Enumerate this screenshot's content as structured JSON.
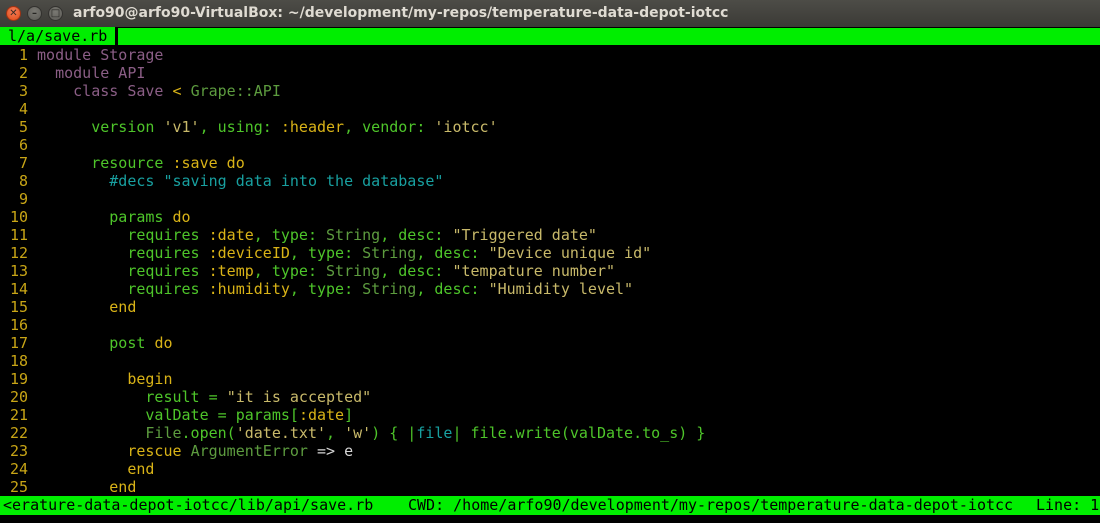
{
  "window": {
    "title": "arfo90@arfo90-VirtualBox: ~/development/my-repos/temperature-data-depot-iotcc",
    "close_glyph": "✕",
    "minimize_glyph": "–",
    "maximize_glyph": "□"
  },
  "tab": {
    "label": "l/a/save.rb"
  },
  "lines": [
    {
      "n": "1",
      "seg": [
        {
          "t": "module Storage",
          "c": "pur"
        }
      ]
    },
    {
      "n": "2",
      "seg": [
        {
          "t": "  module API",
          "c": "pur"
        }
      ]
    },
    {
      "n": "3",
      "seg": [
        {
          "t": "    class Save ",
          "c": "pur"
        },
        {
          "t": "< ",
          "c": "yel"
        },
        {
          "t": "Grape::API",
          "c": "cls"
        }
      ]
    },
    {
      "n": "4",
      "seg": []
    },
    {
      "n": "5",
      "seg": [
        {
          "t": "      version ",
          "c": "grn"
        },
        {
          "t": "'v1'",
          "c": "str"
        },
        {
          "t": ", using: ",
          "c": "grn"
        },
        {
          "t": ":header",
          "c": "yel"
        },
        {
          "t": ", vendor: ",
          "c": "grn"
        },
        {
          "t": "'iotcc'",
          "c": "str"
        }
      ]
    },
    {
      "n": "6",
      "seg": []
    },
    {
      "n": "7",
      "seg": [
        {
          "t": "      resource ",
          "c": "grn"
        },
        {
          "t": ":save",
          "c": "yel"
        },
        {
          "t": " do",
          "c": "yel"
        }
      ]
    },
    {
      "n": "8",
      "seg": [
        {
          "t": "        #decs \"saving data into the database\"",
          "c": "teal"
        }
      ]
    },
    {
      "n": "9",
      "seg": []
    },
    {
      "n": "10",
      "seg": [
        {
          "t": "        params ",
          "c": "grn"
        },
        {
          "t": "do",
          "c": "yel"
        }
      ]
    },
    {
      "n": "11",
      "seg": [
        {
          "t": "          requires ",
          "c": "grn"
        },
        {
          "t": ":date",
          "c": "yel"
        },
        {
          "t": ", type: ",
          "c": "grn"
        },
        {
          "t": "String",
          "c": "cls"
        },
        {
          "t": ", desc: ",
          "c": "grn"
        },
        {
          "t": "\"Triggered date\"",
          "c": "str"
        }
      ]
    },
    {
      "n": "12",
      "seg": [
        {
          "t": "          requires ",
          "c": "grn"
        },
        {
          "t": ":deviceID",
          "c": "yel"
        },
        {
          "t": ", type: ",
          "c": "grn"
        },
        {
          "t": "String",
          "c": "cls"
        },
        {
          "t": ", desc: ",
          "c": "grn"
        },
        {
          "t": "\"Device unique id\"",
          "c": "str"
        }
      ]
    },
    {
      "n": "13",
      "seg": [
        {
          "t": "          requires ",
          "c": "grn"
        },
        {
          "t": ":temp",
          "c": "yel"
        },
        {
          "t": ", type: ",
          "c": "grn"
        },
        {
          "t": "String",
          "c": "cls"
        },
        {
          "t": ", desc: ",
          "c": "grn"
        },
        {
          "t": "\"tempature number\"",
          "c": "str"
        }
      ]
    },
    {
      "n": "14",
      "seg": [
        {
          "t": "          requires ",
          "c": "grn"
        },
        {
          "t": ":humidity",
          "c": "yel"
        },
        {
          "t": ", type: ",
          "c": "grn"
        },
        {
          "t": "String",
          "c": "cls"
        },
        {
          "t": ", desc: ",
          "c": "grn"
        },
        {
          "t": "\"Humidity level\"",
          "c": "str"
        }
      ]
    },
    {
      "n": "15",
      "seg": [
        {
          "t": "        end",
          "c": "yel"
        }
      ]
    },
    {
      "n": "16",
      "seg": []
    },
    {
      "n": "17",
      "seg": [
        {
          "t": "        post ",
          "c": "grn"
        },
        {
          "t": "do",
          "c": "yel"
        }
      ]
    },
    {
      "n": "18",
      "seg": []
    },
    {
      "n": "19",
      "seg": [
        {
          "t": "          begin",
          "c": "yel"
        }
      ]
    },
    {
      "n": "20",
      "seg": [
        {
          "t": "            result = ",
          "c": "grn"
        },
        {
          "t": "\"it is accepted\"",
          "c": "str"
        }
      ]
    },
    {
      "n": "21",
      "seg": [
        {
          "t": "            valDate = params[",
          "c": "grn"
        },
        {
          "t": ":date",
          "c": "yel"
        },
        {
          "t": "]",
          "c": "grn"
        }
      ]
    },
    {
      "n": "22",
      "seg": [
        {
          "t": "            File",
          "c": "cls"
        },
        {
          "t": ".open(",
          "c": "grn"
        },
        {
          "t": "'date.txt'",
          "c": "str"
        },
        {
          "t": ", ",
          "c": "grn"
        },
        {
          "t": "'w'",
          "c": "str"
        },
        {
          "t": ") { |",
          "c": "grn"
        },
        {
          "t": "file",
          "c": "teal"
        },
        {
          "t": "| file.write(valDate.to_s) }",
          "c": "grn"
        }
      ]
    },
    {
      "n": "23",
      "seg": [
        {
          "t": "          rescue ",
          "c": "yel"
        },
        {
          "t": "ArgumentError",
          "c": "cls"
        },
        {
          "t": " => e",
          "c": "wht"
        }
      ]
    },
    {
      "n": "24",
      "seg": [
        {
          "t": "          end",
          "c": "yel"
        }
      ]
    },
    {
      "n": "25",
      "seg": [
        {
          "t": "        end",
          "c": "yel"
        }
      ]
    }
  ],
  "status": {
    "path": "<erature-data-depot-iotcc/lib/api/save.rb",
    "cwd": "CWD: /home/arfo90/development/my-repos/temperature-data-depot-iotcc",
    "line": "Line: 1"
  }
}
